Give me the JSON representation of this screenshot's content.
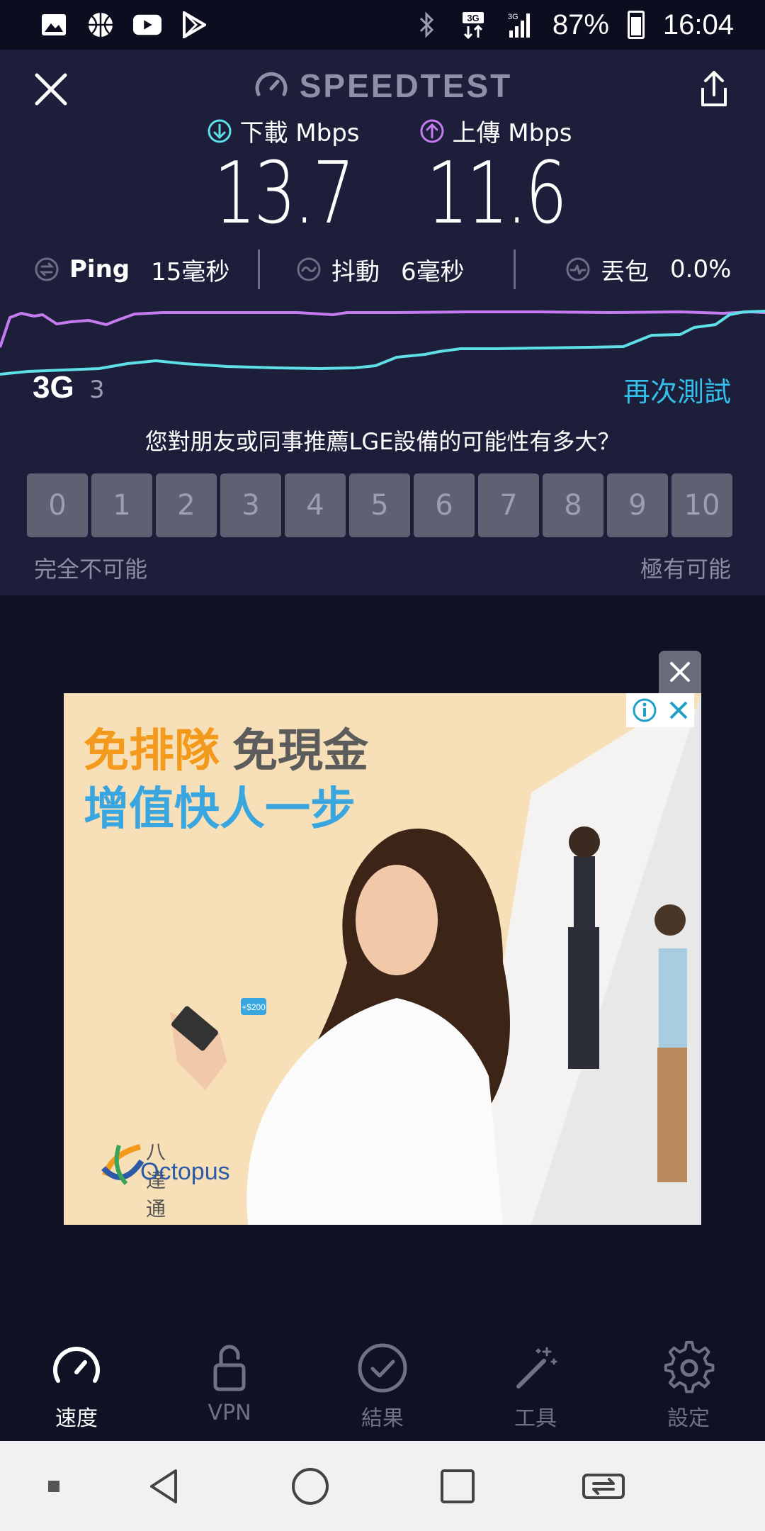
{
  "status_bar": {
    "left_icons": [
      "gallery-icon",
      "basketball-icon",
      "youtube-icon",
      "play-store-icon"
    ],
    "network": "3G",
    "battery": "87%",
    "time": "16:04"
  },
  "header": {
    "brand": "SPEEDTEST"
  },
  "download": {
    "label": "下載 Mbps",
    "value": "13.7"
  },
  "upload": {
    "label": "上傳 Mbps",
    "value": "11.6"
  },
  "stats": {
    "ping_label": "Ping",
    "ping_value": "15毫秒",
    "jitter_label": "抖動",
    "jitter_value": "6毫秒",
    "loss_label": "丟包",
    "loss_value": "0.0%"
  },
  "connection": {
    "type": "3G",
    "sub": "3",
    "retest": "再次測試"
  },
  "survey": {
    "question": "您對朋友或同事推薦LGE設備的可能性有多大？",
    "options": [
      "0",
      "1",
      "2",
      "3",
      "4",
      "5",
      "6",
      "7",
      "8",
      "9",
      "10"
    ],
    "low_label": "完全不可能",
    "high_label": "極有可能"
  },
  "ad": {
    "line1_a": "免排隊",
    "line1_b": "免現金",
    "line2": "增值快人一步",
    "tag": "+$200",
    "brand_cn": "八達通",
    "brand_en": "Octopus"
  },
  "bottom_nav": {
    "items": [
      {
        "label": "速度",
        "icon": "speedometer-icon"
      },
      {
        "label": "VPN",
        "icon": "lock-icon"
      },
      {
        "label": "結果",
        "icon": "check-circle-icon"
      },
      {
        "label": "工具",
        "icon": "magic-wand-icon"
      },
      {
        "label": "設定",
        "icon": "gear-icon"
      }
    ]
  },
  "colors": {
    "panel": "#1c1e3a",
    "background": "#0f1124",
    "download": "#5ee0e6",
    "upload": "#c57bf0",
    "accent": "#33c0ec"
  }
}
